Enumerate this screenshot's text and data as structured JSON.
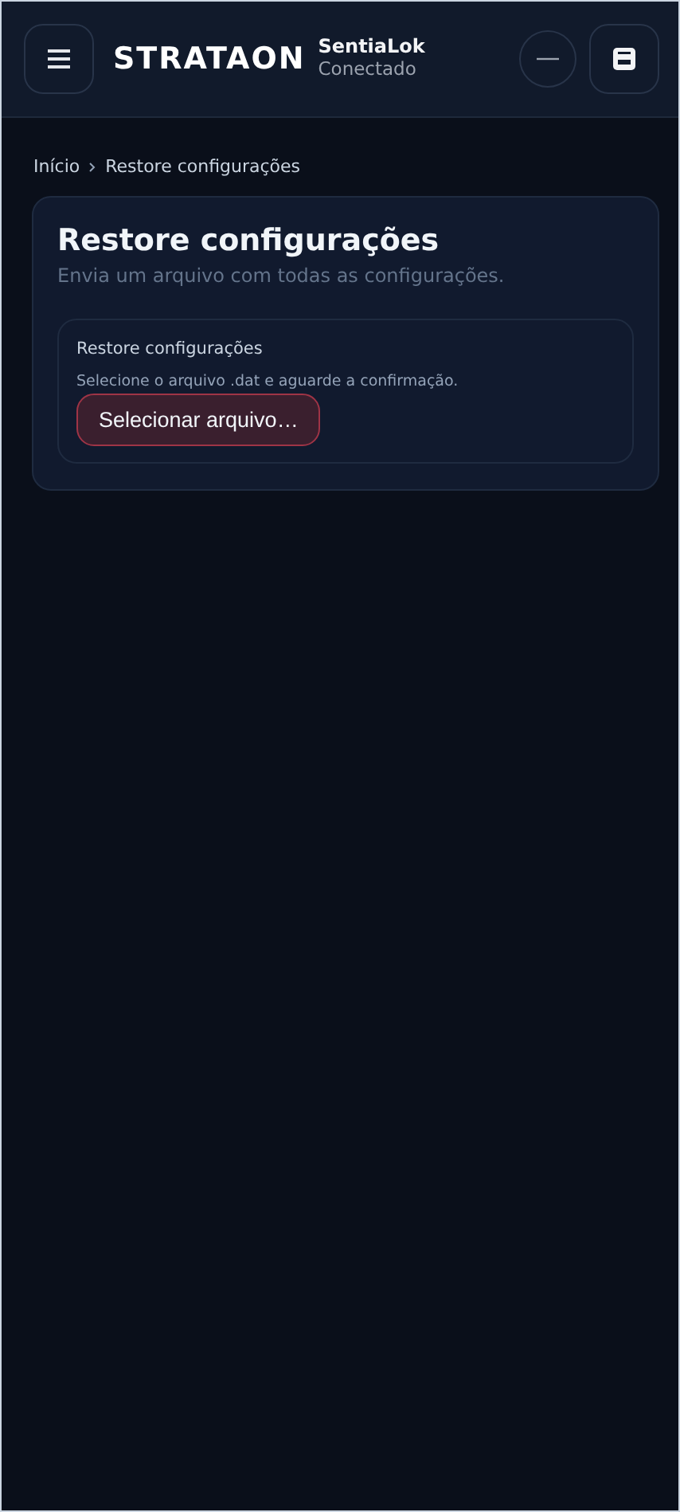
{
  "header": {
    "logo": "STRATAON",
    "device": {
      "name": "SentiaLok",
      "status": "Conectado"
    }
  },
  "breadcrumb": [
    "Início",
    "Restore configurações"
  ],
  "card": {
    "title": "Restore configurações",
    "subtitle": "Envia um arquivo com todas as configurações.",
    "section": {
      "title": "Restore configurações",
      "hint": "Selecione o arquivo .dat e aguarde a confirmação.",
      "button": "Selecionar arquivo…"
    }
  }
}
